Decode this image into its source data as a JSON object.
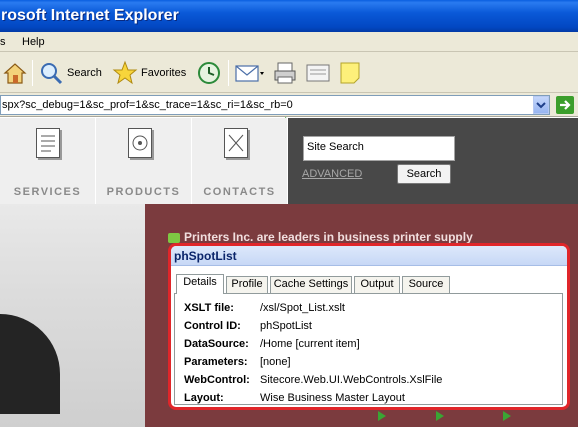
{
  "window": {
    "title": "rosoft Internet Explorer"
  },
  "menu": {
    "items": [
      "s",
      "Help"
    ]
  },
  "toolbar": {
    "home": "home-icon",
    "search_label": "Search",
    "favorites_label": "Favorites",
    "history_icon": "history-icon",
    "mail_icon": "mail-icon",
    "print_icon": "print-icon",
    "edit_icon": "edit-icon",
    "notes_icon": "note-icon"
  },
  "address": {
    "url": "spx?sc_debug=1&sc_prof=1&sc_trace=1&sc_ri=1&sc_rb=0"
  },
  "site_nav": {
    "items": [
      {
        "label": "SERVICES",
        "icon": "document-icon"
      },
      {
        "label": "PRODUCTS",
        "icon": "disc-icon"
      },
      {
        "label": "CONTACTS",
        "icon": "contacts-icon"
      }
    ]
  },
  "search": {
    "placeholder": "Site Search",
    "advanced_link": "ADVANCED",
    "button": "Search"
  },
  "headline": "Printers Inc. are leaders in business printer supply",
  "debug_panel": {
    "title": "phSpotList",
    "tabs": [
      "Details",
      "Profile",
      "Cache Settings",
      "Output",
      "Source"
    ],
    "active_tab": "Details",
    "rows": [
      {
        "key": "XSLT file:",
        "value": "/xsl/Spot_List.xslt"
      },
      {
        "key": "Control ID:",
        "value": "phSpotList"
      },
      {
        "key": "DataSource:",
        "value": "/Home [current item]"
      },
      {
        "key": "Parameters:",
        "value": "[none]"
      },
      {
        "key": "WebControl:",
        "value": "Sitecore.Web.UI.WebControls.XslFile"
      },
      {
        "key": "Layout:",
        "value": "Wise Business Master Layout"
      }
    ]
  },
  "colors": {
    "title_bar": "#0a59d8",
    "debug_border": "#e0262a",
    "maroon": "#7b3b3e",
    "search_panel": "#484848"
  }
}
